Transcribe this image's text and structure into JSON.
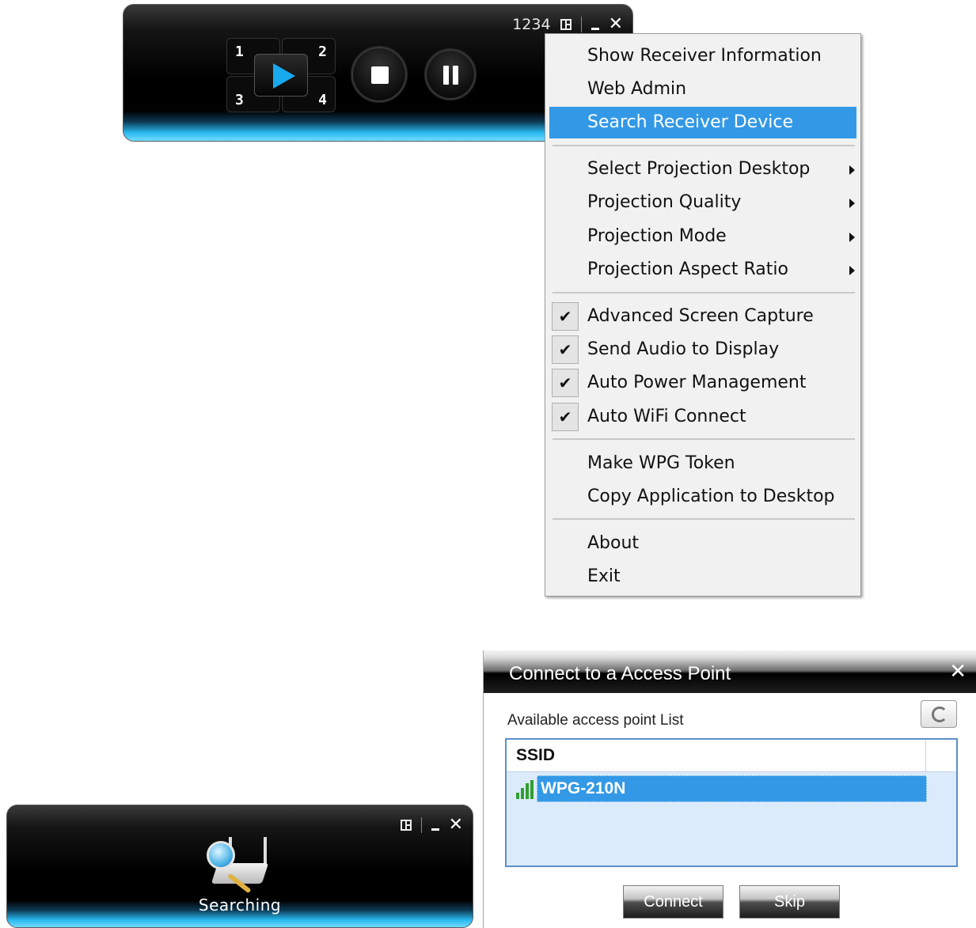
{
  "player": {
    "session_code": "1234",
    "quadrants": [
      "1",
      "2",
      "3",
      "4"
    ]
  },
  "context_menu": {
    "items": [
      {
        "label": "Show Receiver Information"
      },
      {
        "label": "Web Admin"
      },
      {
        "label": "Search Receiver Device",
        "highlighted": true
      },
      {
        "label": "Select Projection Desktop",
        "submenu": true
      },
      {
        "label": "Projection Quality",
        "submenu": true
      },
      {
        "label": "Projection Mode",
        "submenu": true
      },
      {
        "label": "Projection Aspect Ratio",
        "submenu": true
      },
      {
        "label": "Advanced Screen Capture",
        "checked": true
      },
      {
        "label": "Send Audio to Display",
        "checked": true
      },
      {
        "label": "Auto Power Management",
        "checked": true
      },
      {
        "label": "Auto WiFi Connect",
        "checked": true
      },
      {
        "label": "Make WPG Token"
      },
      {
        "label": "Copy Application to Desktop"
      },
      {
        "label": "About"
      },
      {
        "label": "Exit"
      }
    ],
    "check_glyph": "✔"
  },
  "search_bar": {
    "status": "Searching"
  },
  "ap_dialog": {
    "title": "Connect to a Access Point",
    "close_glyph": "✕",
    "list_label": "Available access point List",
    "column_header": "SSID",
    "access_points": [
      {
        "ssid": "WPG-210N",
        "selected": true
      }
    ],
    "connect_label": "Connect",
    "skip_label": "Skip"
  },
  "colors": {
    "highlight": "#3399e6",
    "accent_blue": "#19a9ee",
    "signal_green": "#2fa02f"
  }
}
